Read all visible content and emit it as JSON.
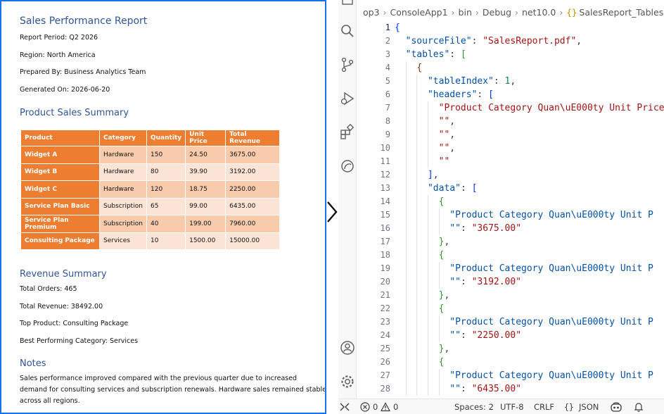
{
  "document": {
    "title": "Sales Performance Report",
    "meta": [
      "Report Period: Q2 2026",
      "Region: North America",
      "Prepared By: Business Analytics Team",
      "Generated On: 2026-06-20"
    ],
    "product_heading": "Product Sales Summary",
    "table": {
      "headers": [
        "Product",
        "Category",
        "Quantity",
        "Unit Price",
        "Total Revenue"
      ],
      "rows": [
        [
          "Widget A",
          "Hardware",
          "150",
          "24.50",
          "3675.00"
        ],
        [
          "Widget B",
          "Hardware",
          "80",
          "39.90",
          "3192.00"
        ],
        [
          "Widget C",
          "Hardware",
          "120",
          "18.75",
          "2250.00"
        ],
        [
          "Service Plan Basic",
          "Subscription",
          "65",
          "99.00",
          "6435.00"
        ],
        [
          "Service Plan Premium",
          "Subscription",
          "40",
          "199.00",
          "7960.00"
        ],
        [
          "Consulting Package",
          "Services",
          "10",
          "1500.00",
          "15000.00"
        ]
      ]
    },
    "revenue_heading": "Revenue Summary",
    "revenue_lines": [
      "Total Orders: 465",
      "Total Revenue: 38492.00",
      "Top Product: Consulting Package",
      "Best Performing Category: Services"
    ],
    "notes_heading": "Notes",
    "notes_text": "Sales performance improved compared with the previous quarter due to increased demand for consulting services and subscription renewals. Hardware sales remained stable across all regions."
  },
  "editor": {
    "breadcrumb": [
      "op3",
      "ConsoleApp1",
      "bin",
      "Debug",
      "net10.0"
    ],
    "file_braces": "{}",
    "file_name": "SalesReport_Tables.json",
    "active_line": "1",
    "line_numbers": [
      "1",
      "2",
      "3",
      "4",
      "5",
      "6",
      "7",
      "8",
      "9",
      "10",
      "11",
      "12",
      "13",
      "14",
      "15",
      "16",
      "17",
      "18",
      "19",
      "20",
      "21",
      "22",
      "23",
      "24",
      "25",
      "26",
      "27",
      "28"
    ],
    "code_strings": {
      "k_sourceFile": "\"sourceFile\"",
      "v_sourceFile": "\"SalesReport.pdf\"",
      "k_tables": "\"tables\"",
      "k_tableIndex": "\"tableIndex\"",
      "v_tableIndex": "1",
      "k_headers": "\"headers\"",
      "v_header0": "\"Product Category Quan\\uE000ty Unit Price",
      "v_empty": "\"\"",
      "k_data": "\"data\"",
      "k_row": "\"Product Category Quan\\uE000ty Unit P",
      "v_3675": "\"3675.00\"",
      "v_3192": "\"3192.00\"",
      "v_2250": "\"2250.00\"",
      "v_6435": "\"6435.00\""
    }
  },
  "status_bar": {
    "remote_icon": "remote-icon",
    "errors": "0",
    "warnings": "0",
    "spaces": "Spaces: 2",
    "encoding": "UTF-8",
    "eol": "CRLF",
    "language_braces": "{}",
    "language": "JSON"
  }
}
